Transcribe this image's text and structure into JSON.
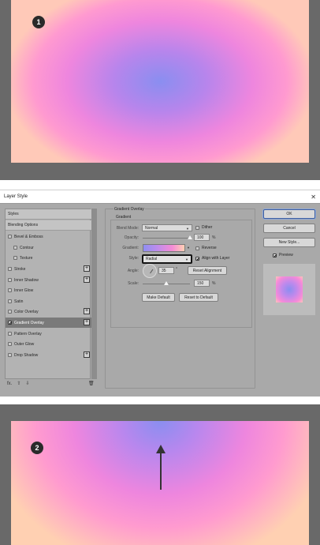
{
  "top_image": {
    "badge": "1"
  },
  "bottom_image": {
    "badge": "2"
  },
  "dialog": {
    "title": "Layer Style",
    "close_glyph": "✕",
    "styles_items": [
      {
        "label": "Styles",
        "kind": "header"
      },
      {
        "label": "Blending Options",
        "kind": "header"
      },
      {
        "label": "Bevel & Emboss",
        "checked": false,
        "plus": false
      },
      {
        "label": "Contour",
        "checked": false,
        "indent": true
      },
      {
        "label": "Texture",
        "checked": false,
        "indent": true
      },
      {
        "label": "Stroke",
        "checked": false,
        "plus": true
      },
      {
        "label": "Inner Shadow",
        "checked": false,
        "plus": true
      },
      {
        "label": "Inner Glow",
        "checked": false,
        "plus": false
      },
      {
        "label": "Satin",
        "checked": false,
        "plus": false
      },
      {
        "label": "Color Overlay",
        "checked": false,
        "plus": true
      },
      {
        "label": "Gradient Overlay",
        "checked": true,
        "plus": true,
        "selected": true
      },
      {
        "label": "Pattern Overlay",
        "checked": false,
        "plus": false
      },
      {
        "label": "Outer Glow",
        "checked": false,
        "plus": false
      },
      {
        "label": "Drop Shadow",
        "checked": false,
        "plus": true
      }
    ],
    "bottom_icons": {
      "fx": "fx.",
      "up": "⇧",
      "down": "⇩",
      "trash": "🗑"
    },
    "section_title": "Gradient Overlay",
    "subsection_title": "Gradient",
    "blend_mode": {
      "label": "Blend Mode:",
      "value": "Normal"
    },
    "dither": {
      "label": "Dither",
      "checked": false
    },
    "opacity": {
      "label": "Opacity:",
      "value": "100",
      "unit": "%",
      "level": 1.0
    },
    "gradient": {
      "label": "Gradient:"
    },
    "reverse": {
      "label": "Reverse",
      "checked": false
    },
    "style": {
      "label": "Style:",
      "value": "Radial"
    },
    "align_with_layer": {
      "label": "Align with Layer",
      "checked": true
    },
    "angle": {
      "label": "Angle:",
      "value": "35",
      "unit": "°"
    },
    "reset_alignment": "Reset Alignment",
    "scale": {
      "label": "Scale:",
      "value": "150",
      "unit": "%",
      "level": 0.5
    },
    "make_default": "Make Default",
    "reset_to_default": "Reset to Default",
    "buttons": {
      "ok": "OK",
      "cancel": "Cancel",
      "new_style": "New Style..."
    },
    "preview": {
      "label": "Preview",
      "checked": true
    }
  }
}
